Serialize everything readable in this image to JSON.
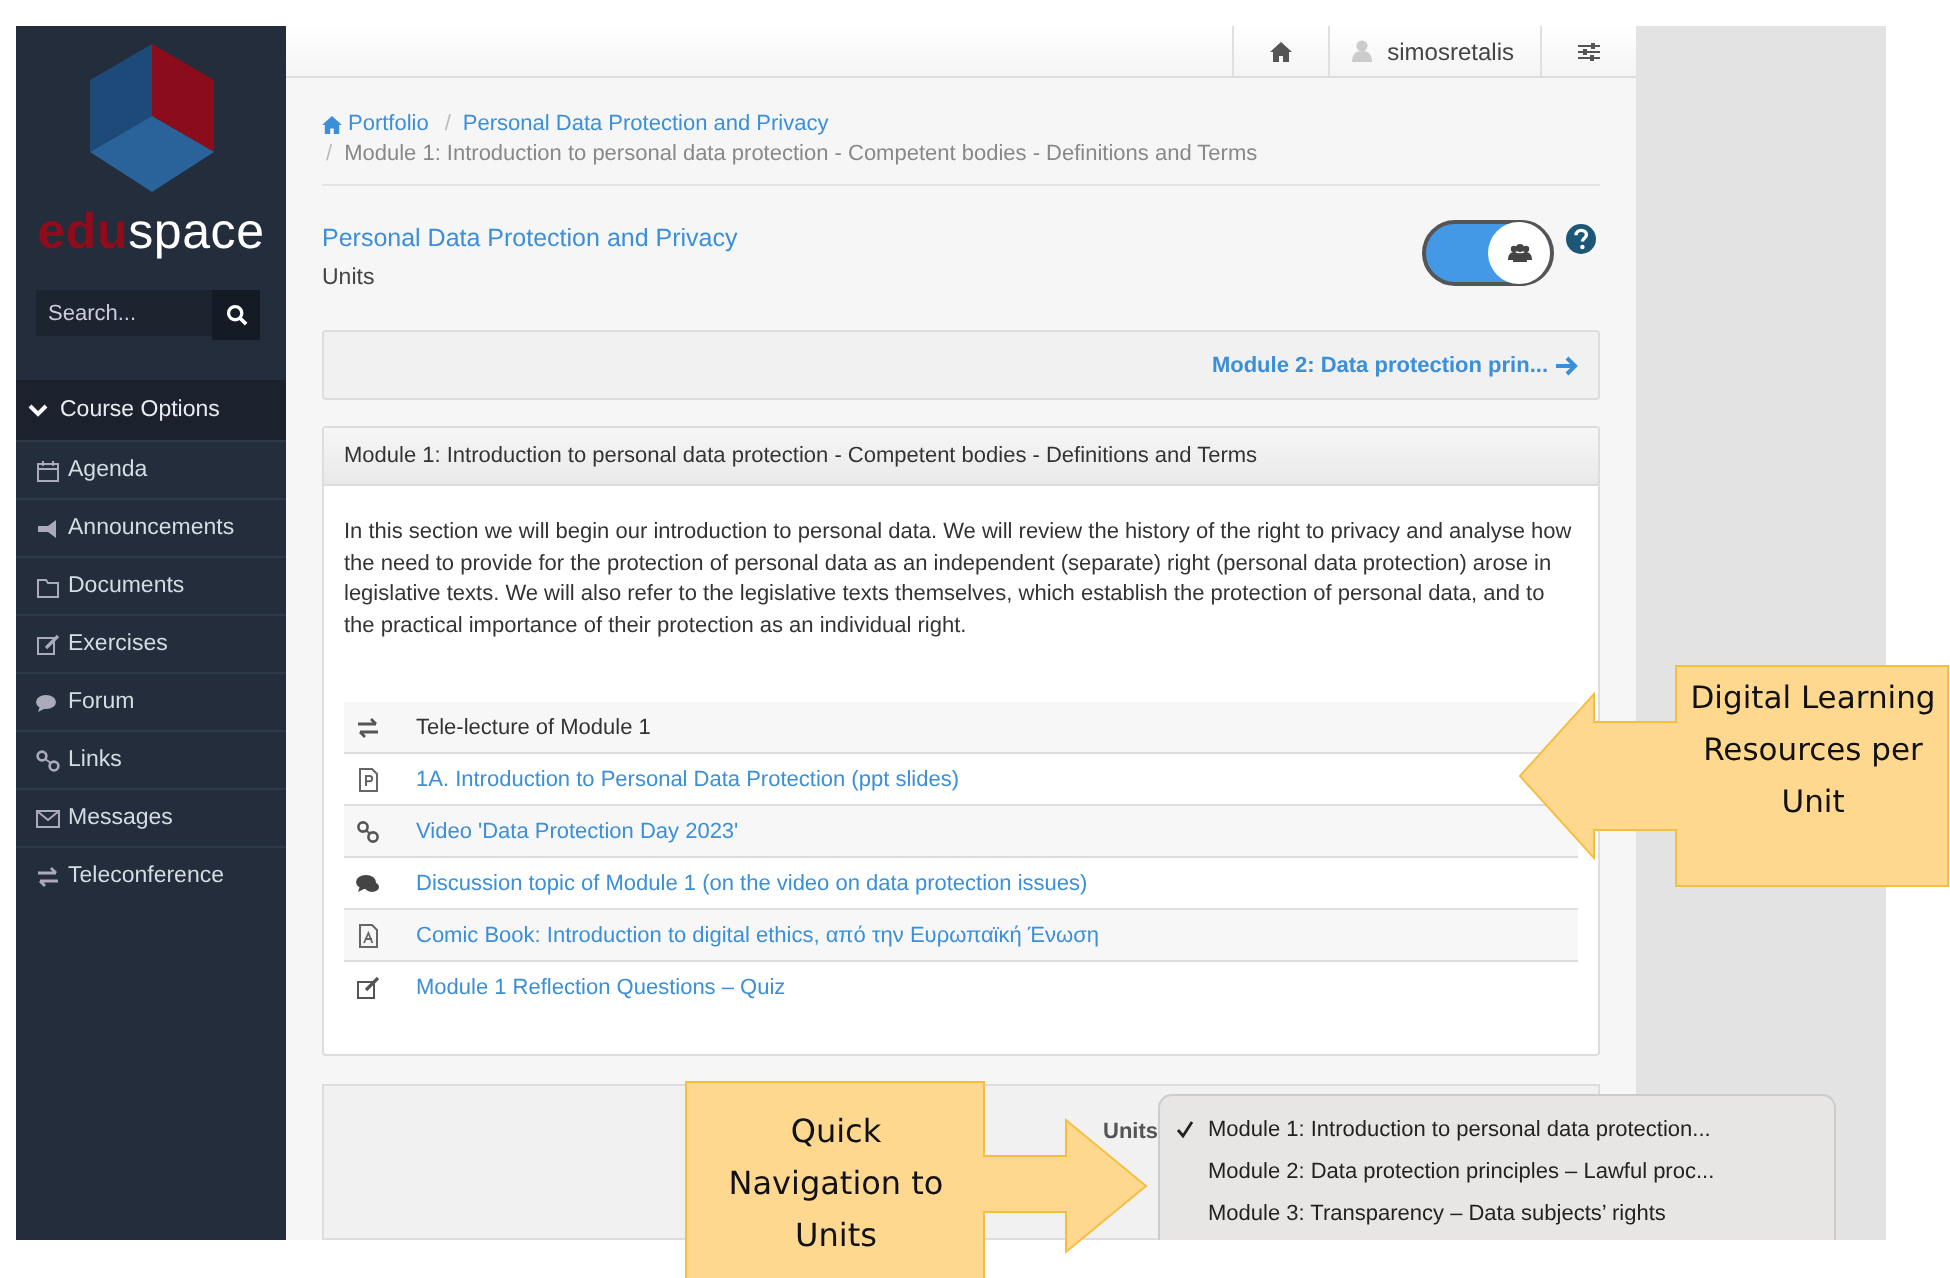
{
  "sidebar": {
    "logo": {
      "accent": "edu",
      "rest": "space"
    },
    "search": {
      "placeholder": "Search..."
    },
    "section": {
      "label": "Course Options",
      "expanded": true
    },
    "items": [
      {
        "kind": "agenda",
        "label": "Agenda"
      },
      {
        "kind": "announcements",
        "label": "Announcements"
      },
      {
        "kind": "documents",
        "label": "Documents"
      },
      {
        "kind": "exercises",
        "label": "Exercises"
      },
      {
        "kind": "forum",
        "label": "Forum"
      },
      {
        "kind": "links",
        "label": "Links"
      },
      {
        "kind": "messages",
        "label": "Messages"
      },
      {
        "kind": "teleconference",
        "label": "Teleconference"
      }
    ]
  },
  "topbar": {
    "user": "simosretalis"
  },
  "breadcrumb": {
    "separator": "/",
    "items": [
      "Portfolio",
      "Personal Data Protection and Privacy"
    ],
    "current": "Module 1: Introduction to personal data protection - Competent bodies - Definitions and Terms"
  },
  "course": {
    "title": "Personal Data Protection and Privacy",
    "subtitle": "Units",
    "toggle_on": true
  },
  "next_link": "Module 2: Data protection prin...",
  "module": {
    "title": "Module 1: Introduction to personal data protection - Competent bodies - Definitions and Terms",
    "description": "In this section we will begin our introduction to personal data. We will review the history of the right to privacy and analyse how the need to provide for the protection of personal data as an independent (separate) right (personal data protection) arose in legislative texts. We will also refer to the legislative texts themselves, which establish the protection of personal data, and to the practical importance of their protection as an individual right.",
    "resources": [
      {
        "kind": "teleconference",
        "label": "Tele-lecture of Module 1"
      },
      {
        "kind": "ppt",
        "label": "1A. Introduction to Personal Data Protection (ppt slides)"
      },
      {
        "kind": "link",
        "label": "Video 'Data Protection Day 2023'"
      },
      {
        "kind": "forum",
        "label": "Discussion topic of Module 1 (on the video on data protection issues)"
      },
      {
        "kind": "pdf",
        "label": "Comic Book: Introduction to digital ethics, από την Ευρωπαϊκή Ένωση"
      },
      {
        "kind": "exercise",
        "label": "Module 1 Reflection Questions – Quiz"
      }
    ]
  },
  "units_nav": {
    "label": "Units",
    "options": [
      {
        "label": "Module 1: Introduction to personal data protection...",
        "selected": true
      },
      {
        "label": "Module 2: Data protection principles – Lawful proc...",
        "selected": false
      },
      {
        "label": "Module 3: Transparency – Data subjects’ rights",
        "selected": false
      }
    ]
  },
  "callouts": [
    {
      "kind": "left",
      "text": "Digital Learning Resources per Unit"
    },
    {
      "kind": "right",
      "text": "Quick Navigation to Units"
    }
  ]
}
